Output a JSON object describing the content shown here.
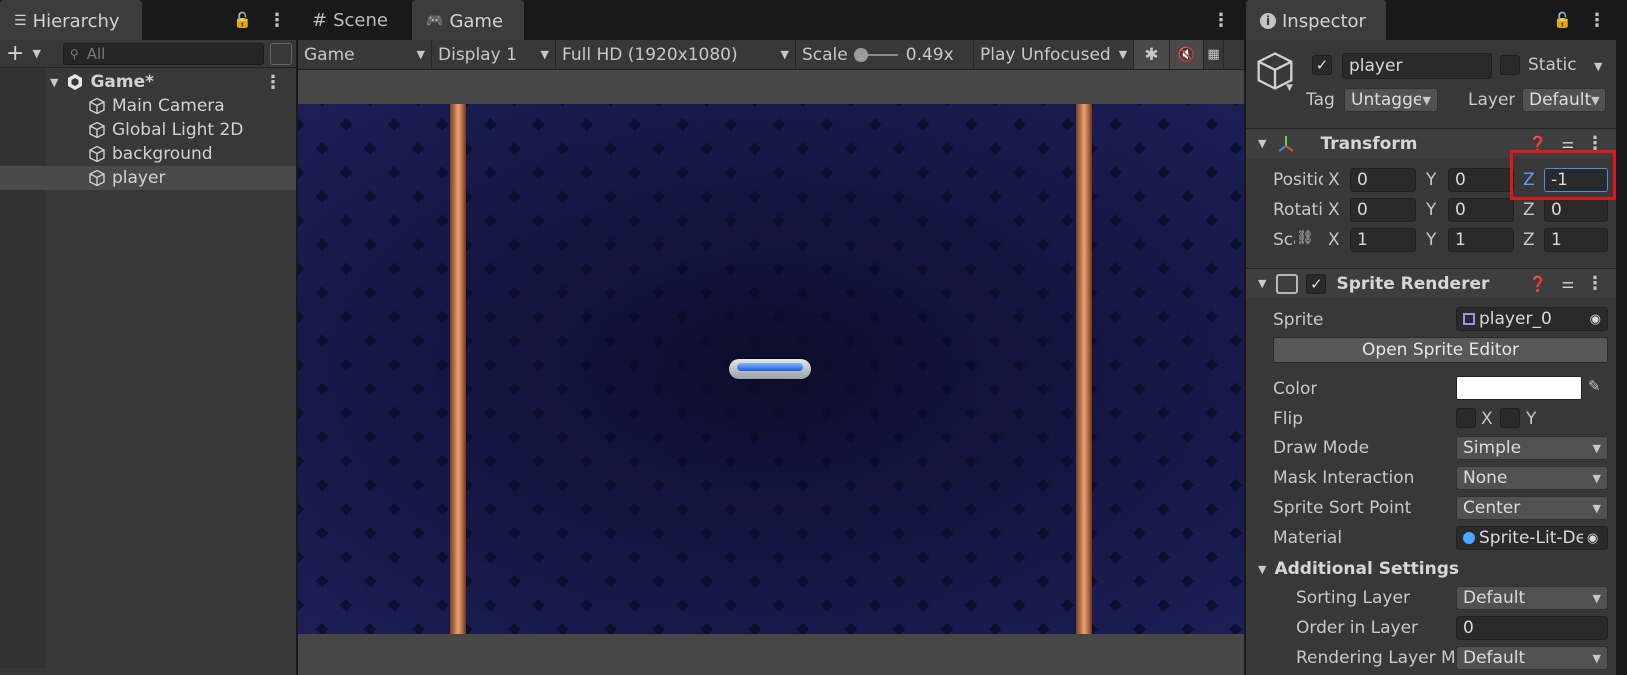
{
  "hierarchy": {
    "tab_label": "Hierarchy",
    "search_placeholder": "All",
    "root": "Game*",
    "items": [
      "Main Camera",
      "Global Light 2D",
      "background",
      "player"
    ]
  },
  "game_view": {
    "tabs": [
      "Scene",
      "Game"
    ],
    "active_tab": "Game",
    "toolbar": {
      "mode": "Game",
      "display": "Display 1",
      "resolution": "Full HD (1920x1080)",
      "scale_label": "Scale",
      "scale_value": "0.49x",
      "play_mode": "Play Unfocused"
    }
  },
  "inspector": {
    "tab_label": "Inspector",
    "object_name": "player",
    "static_label": "Static",
    "tag_label": "Tag",
    "tag_value": "Untagged",
    "layer_label": "Layer",
    "layer_value": "Default",
    "transform": {
      "title": "Transform",
      "position_label": "Position",
      "rotation_label": "Rotation",
      "scale_label": "Scale",
      "position": {
        "x": "0",
        "y": "0",
        "z": "-1"
      },
      "rotation": {
        "x": "0",
        "y": "0",
        "z": "0"
      },
      "scale": {
        "x": "1",
        "y": "1",
        "z": "1"
      }
    },
    "sprite_renderer": {
      "title": "Sprite Renderer",
      "sprite_label": "Sprite",
      "sprite_value": "player_0",
      "open_editor": "Open Sprite Editor",
      "color_label": "Color",
      "flip_label": "Flip",
      "flip_x": "X",
      "flip_y": "Y",
      "draw_mode_label": "Draw Mode",
      "draw_mode_value": "Simple",
      "mask_label": "Mask Interaction",
      "mask_value": "None",
      "sort_point_label": "Sprite Sort Point",
      "sort_point_value": "Center",
      "material_label": "Material",
      "material_value": "Sprite-Lit-Default",
      "additional_title": "Additional Settings",
      "sorting_layer_label": "Sorting Layer",
      "sorting_layer_value": "Default",
      "order_label": "Order in Layer",
      "order_value": "0",
      "rendering_layer_label": "Rendering Layer Mask",
      "rendering_layer_value": "Default"
    }
  },
  "colors": {
    "highlight": "#e0161c",
    "game_bg": "#101236",
    "wall": "#d08a5d"
  }
}
